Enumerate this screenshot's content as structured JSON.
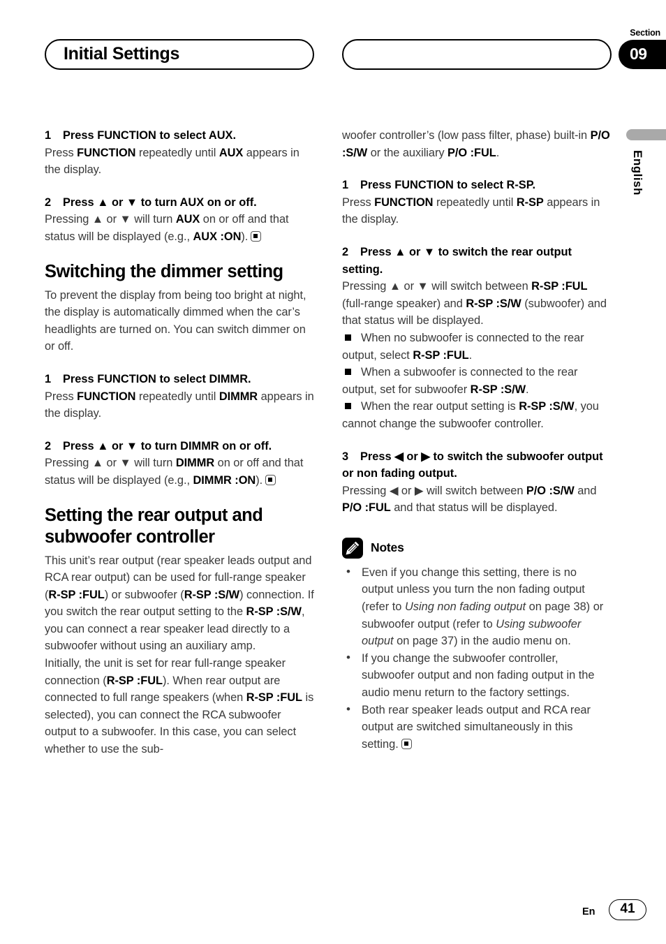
{
  "header": {
    "left_title": "Initial Settings",
    "right_title": "",
    "section_label": "Section",
    "section_number": "09"
  },
  "margin": {
    "language": "English"
  },
  "left_column": {
    "aux_step1": {
      "number": "1",
      "heading": "Press FUNCTION to select AUX.",
      "body_pre": "Press ",
      "body_b1": "FUNCTION",
      "body_mid": " repeatedly until ",
      "body_b2": "AUX",
      "body_post": " appears in the display."
    },
    "aux_step2": {
      "number": "2",
      "heading": "Press ▲ or ▼ to turn AUX on or off.",
      "body_pre": "Pressing ▲ or ▼ will turn ",
      "body_b1": "AUX",
      "body_mid": " on or off and that status will be displayed (e.g., ",
      "body_b2": "AUX :ON",
      "body_post": ")."
    },
    "dimmer_section": {
      "title": "Switching the dimmer setting",
      "intro": "To prevent the display from being too bright at night, the display is automatically dimmed when the car’s headlights are turned on. You can switch dimmer on or off."
    },
    "dimmr_step1": {
      "number": "1",
      "heading": "Press FUNCTION to select DIMMR.",
      "body_pre": "Press ",
      "body_b1": "FUNCTION",
      "body_mid": " repeatedly until ",
      "body_b2": "DIMMR",
      "body_post": " appears in the display."
    },
    "dimmr_step2": {
      "number": "2",
      "heading": "Press ▲ or ▼ to turn DIMMR on or off.",
      "body_pre": "Pressing ▲ or ▼ will turn ",
      "body_b1": "DIMMR",
      "body_mid": " on or off and that status will be displayed (e.g., ",
      "body_b2": "DIMMR :ON",
      "body_post": ")."
    },
    "rear_section": {
      "title": "Setting the rear output and subwoofer controller",
      "p1_a": "This unit’s rear output (rear speaker leads output and RCA rear output) can be used for full-range speaker (",
      "p1_b1": "R-SP :FUL",
      "p1_b": ") or subwoofer (",
      "p1_b2": "R-SP :S/W",
      "p1_c": ") connection. If you switch the rear output setting to the ",
      "p1_b3": "R-SP :S/W",
      "p1_d": ", you can connect a rear speaker lead directly to a subwoofer without using an auxiliary amp.",
      "p2_a": "Initially, the unit is set for rear full-range speaker connection (",
      "p2_b1": "R-SP :FUL",
      "p2_b": "). When rear output are connected to full range speakers (when ",
      "p2_b2": "R-SP :FUL",
      "p2_c": " is selected), you can connect the RCA subwoofer output to a subwoofer. In this case, you can select whether to use the sub-"
    }
  },
  "right_column": {
    "continuation": {
      "a": "woofer controller’s (low pass filter, phase) built-in ",
      "b1": "P/O :S/W",
      "b": " or the auxiliary ",
      "b2": "P/O :FUL",
      "c": "."
    },
    "rsp_step1": {
      "number": "1",
      "heading": "Press FUNCTION to select R-SP.",
      "body_pre": "Press ",
      "body_b1": "FUNCTION",
      "body_mid": " repeatedly until ",
      "body_b2": "R-SP",
      "body_post": " appears in the display."
    },
    "rsp_step2": {
      "number": "2",
      "heading": "Press ▲ or ▼ to switch the rear output setting.",
      "body_pre": "Pressing ▲ or ▼ will switch between ",
      "body_b1": "R-SP :FUL",
      "body_mid": " (full-range speaker) and ",
      "body_b2": "R-SP :S/W",
      "body_post": " (subwoofer) and that status will be displayed.",
      "bullets": [
        {
          "a": "When no subwoofer is connected to the rear output, select ",
          "b": "R-SP :FUL",
          "c": "."
        },
        {
          "a": "When a subwoofer is connected to the rear output, set for subwoofer ",
          "b": "R-SP :S/W",
          "c": "."
        },
        {
          "a": "When the rear output setting is ",
          "b": "R-SP :S/W",
          "c": ", you cannot change the subwoofer controller."
        }
      ]
    },
    "rsp_step3": {
      "number": "3",
      "heading": "Press ◀ or ▶ to switch the subwoofer output or non fading output.",
      "body_pre": "Pressing ◀ or ▶ will switch between ",
      "body_b1": "P/O :S/W",
      "body_mid": " and ",
      "body_b2": "P/O :FUL",
      "body_post": " and that status will be displayed."
    },
    "notes": {
      "title": "Notes",
      "items": [
        {
          "a": "Even if you change this setting, there is no output unless you turn the non fading output (refer to ",
          "i1": "Using non fading output",
          "b": " on page 38) or subwoofer output (refer to ",
          "i2": "Using subwoofer output",
          "c": " on page 37) in the audio menu on.",
          "endmark": false
        },
        {
          "a": "If you change the subwoofer controller, subwoofer output and non fading output in the audio menu return to the factory settings.",
          "i1": "",
          "b": "",
          "i2": "",
          "c": "",
          "endmark": false
        },
        {
          "a": "Both rear speaker leads output and RCA rear output are switched simultaneously in this setting.",
          "i1": "",
          "b": "",
          "i2": "",
          "c": "",
          "endmark": true
        }
      ]
    }
  },
  "footer": {
    "language_code": "En",
    "page_number": "41"
  }
}
